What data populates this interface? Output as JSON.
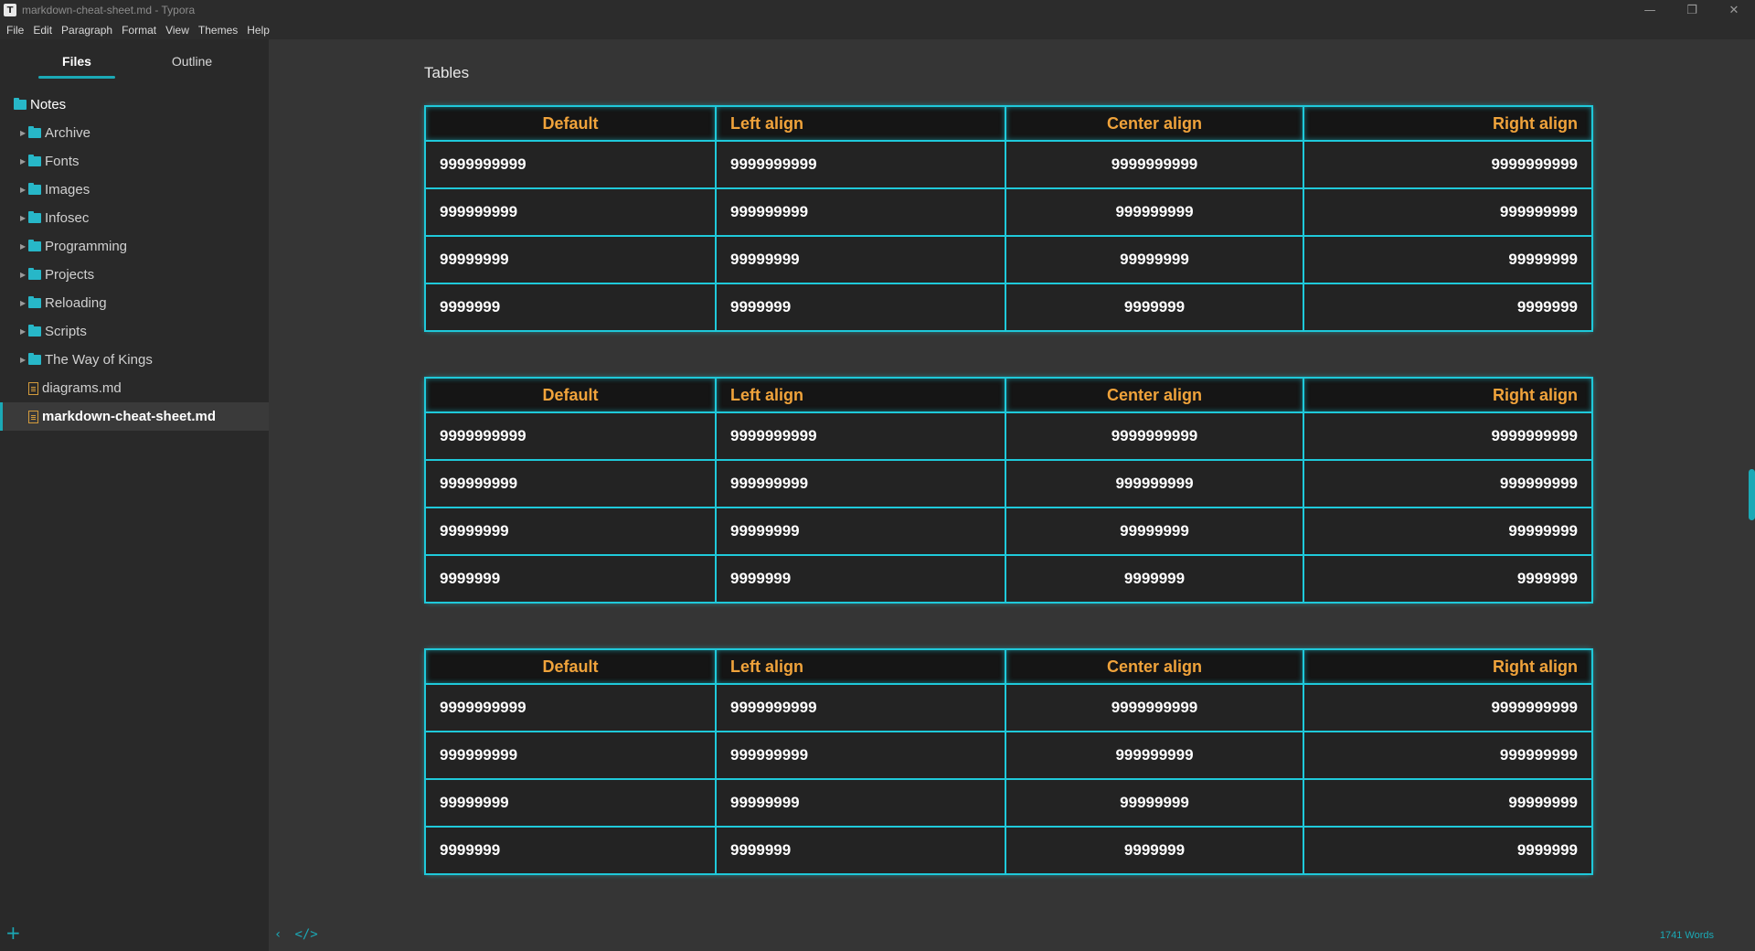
{
  "window": {
    "title": "markdown-cheat-sheet.md - Typora",
    "app_icon_letter": "T",
    "min_glyph": "—",
    "max_glyph": "❐",
    "close_glyph": "✕"
  },
  "menu": [
    "File",
    "Edit",
    "Paragraph",
    "Format",
    "View",
    "Themes",
    "Help"
  ],
  "sidebar": {
    "tabs": {
      "files": "Files",
      "outline": "Outline"
    },
    "root": "Notes",
    "folders": [
      "Archive",
      "Fonts",
      "Images",
      "Infosec",
      "Programming",
      "Projects",
      "Reloading",
      "Scripts",
      "The Way of Kings"
    ],
    "files": [
      "diagrams.md",
      "markdown-cheat-sheet.md"
    ],
    "active_file": "markdown-cheat-sheet.md",
    "add_glyph": "+"
  },
  "content": {
    "heading": "Tables",
    "headers": [
      "Default",
      "Left align",
      "Center align",
      "Right align"
    ],
    "rows": [
      [
        "9999999999",
        "9999999999",
        "9999999999",
        "9999999999"
      ],
      [
        "999999999",
        "999999999",
        "999999999",
        "999999999"
      ],
      [
        "99999999",
        "99999999",
        "99999999",
        "99999999"
      ],
      [
        "9999999",
        "9999999",
        "9999999",
        "9999999"
      ]
    ]
  },
  "status": {
    "back_glyph": "‹",
    "source_glyph": "</>",
    "word_count": "1741 Words"
  },
  "colors": {
    "accent": "#1ba9b6",
    "table_border": "#1fc9da",
    "header_text": "#f0a33b",
    "background": "#353535",
    "sidebar": "#292929"
  }
}
